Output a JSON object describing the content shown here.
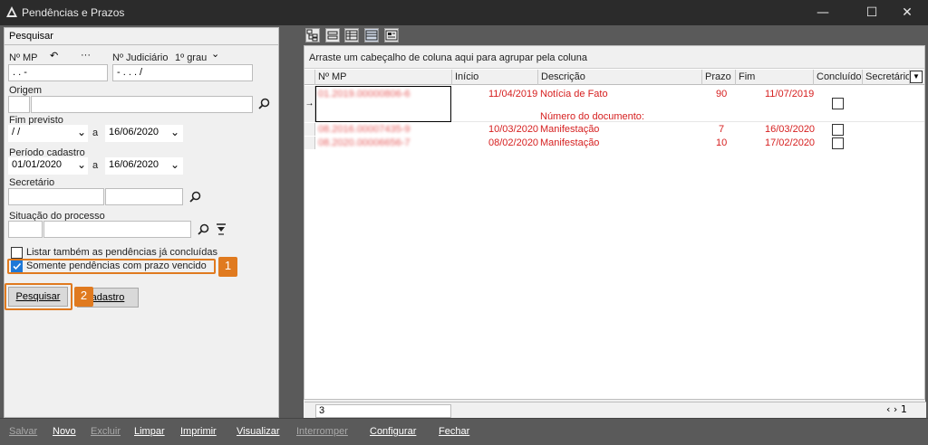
{
  "window": {
    "title": "Pendências e Prazos",
    "minimize": "—",
    "maximize": "☐",
    "close": "✕"
  },
  "filters": {
    "section_title": "Pesquisar",
    "nmp_label": "Nº MP",
    "nmp_value": " .   .        -",
    "njud_label": "Nº Judiciário",
    "grau_label": "1º grau",
    "njud_value": "  -  .    .  .    /",
    "origem_label": "Origem",
    "fim_previsto_label": "Fim previsto",
    "fim_from": " / /",
    "a1": "a",
    "fim_to": "16/06/2020",
    "periodo_label": "Período cadastro",
    "periodo_from": "01/01/2020",
    "a2": "a",
    "periodo_to": "16/06/2020",
    "secretario_label": "Secretário",
    "situacao_label": "Situação do processo",
    "check_listar": "Listar também as pendências já concluídas",
    "check_somente": "Somente pendências com prazo vencido",
    "badge1": "1",
    "badge2": "2",
    "btn_pesquisar": "Pesquisar",
    "btn_cadastro": "adastro"
  },
  "grid": {
    "group_hint": "Arraste um cabeçalho de coluna aqui para agrupar pela coluna",
    "columns": [
      "Nº MP",
      "Início",
      "Descrição",
      "Prazo",
      "Fim",
      "Concluído",
      "Secretário"
    ],
    "rows": [
      {
        "nmp": "01.2019.00000806-6",
        "inicio": "11/04/2019",
        "descricao": "Notícia de Fato",
        "prazo": "90",
        "fim": "11/07/2019",
        "extra": "Número do documento:"
      },
      {
        "nmp": "08.2016.00007435-9",
        "inicio": "10/03/2020",
        "descricao": "Manifestação",
        "prazo": "7",
        "fim": "16/03/2020"
      },
      {
        "nmp": "08.2020.00006656-7",
        "inicio": "08/02/2020",
        "descricao": "Manifestação",
        "prazo": "10",
        "fim": "17/02/2020"
      }
    ],
    "count": "3",
    "pager": "1"
  },
  "bottom": [
    "Salvar",
    "Novo",
    "Excluir",
    "Limpar",
    "Imprimir",
    "Visualizar",
    "Interromper",
    "Configurar",
    "Fechar"
  ],
  "colors": {
    "accent": "#e07a1f",
    "row_text": "#d62020",
    "check": "#1e78d7"
  }
}
